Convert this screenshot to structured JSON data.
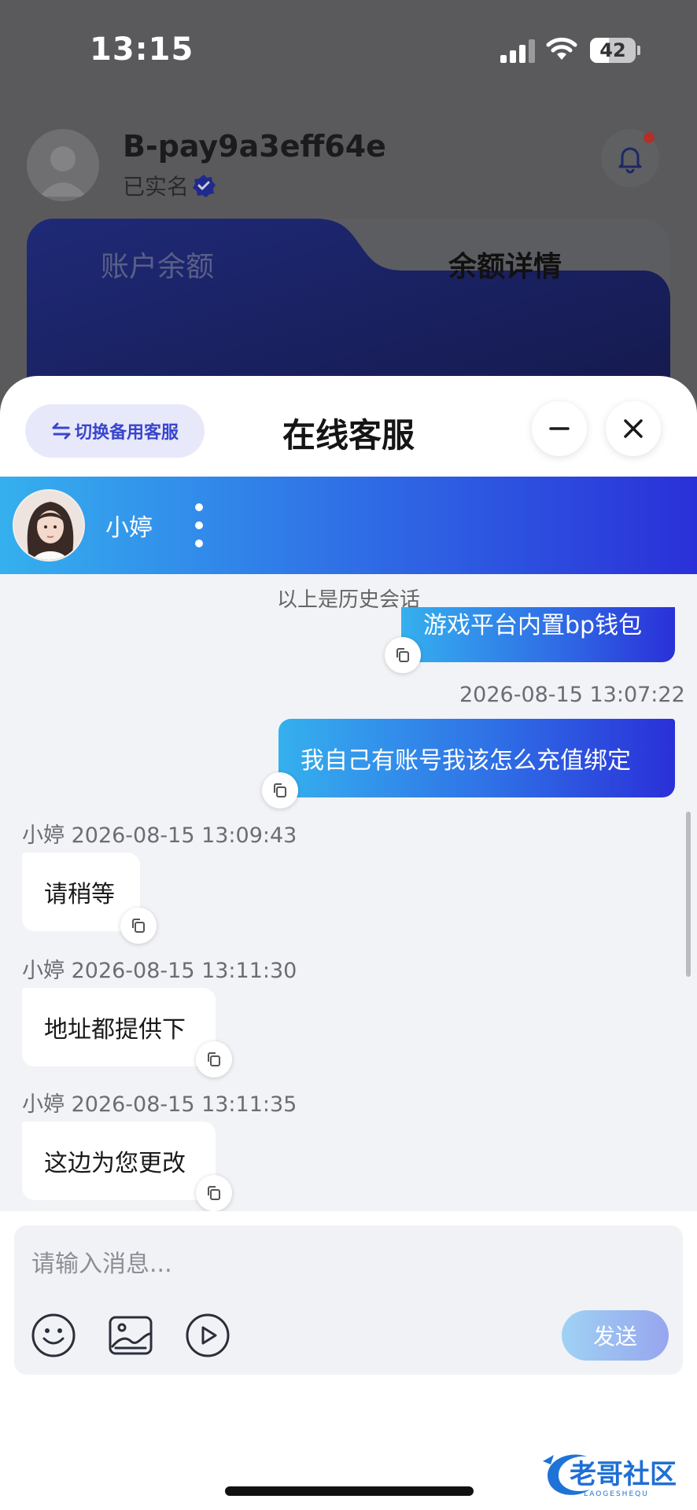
{
  "status_bar": {
    "time": "13:15",
    "battery": "42"
  },
  "background": {
    "username": "B-pay9a3eff64e",
    "verified_label": "已实名",
    "tabs": [
      "账户余额",
      "余额详情"
    ]
  },
  "chat_sheet": {
    "switch_label": "切换备用客服",
    "title": "在线客服",
    "agent_name": "小婷",
    "history_note": "以上是历史会话",
    "messages": [
      {
        "text": "游戏平台内置bp钱包"
      },
      {
        "time": "2026-08-15 13:07:22",
        "text": "我自己有账号我该怎么充值绑定"
      },
      {
        "header": "小婷 2026-08-15 13:09:43",
        "text": "请稍等"
      },
      {
        "header": "小婷 2026-08-15 13:11:30",
        "text": "地址都提供下"
      },
      {
        "header": "小婷 2026-08-15 13:11:35",
        "text": "这边为您更改"
      }
    ],
    "input_placeholder": "请输入消息...",
    "send_label": "发送"
  },
  "watermark": {
    "text": "老哥社区",
    "subtext": "LAOGESHEQU"
  },
  "colors": {
    "accent_start": "#35b0ee",
    "accent_end": "#2a30d8",
    "switch_text": "#3a45cc"
  }
}
